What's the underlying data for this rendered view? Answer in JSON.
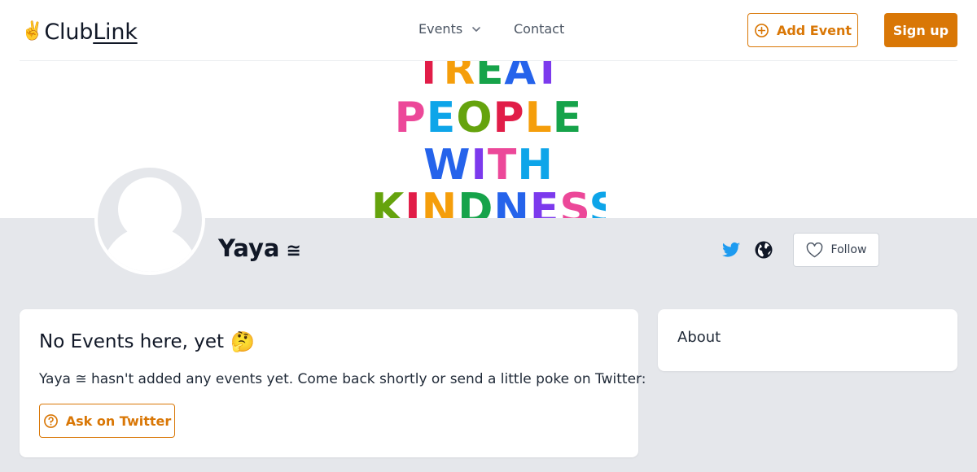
{
  "header": {
    "logo_emoji": "✌️",
    "logo_text_a": "Club",
    "logo_text_b": "Link",
    "nav": {
      "events_label": "Events",
      "contact_label": "Contact"
    },
    "add_event_label": "Add Event",
    "signup_label": "Sign up"
  },
  "banner": {
    "lines": [
      "TREAT",
      "PEOPLE",
      "WITH",
      "KINDNESS"
    ],
    "colors": [
      "#e11d48",
      "#f59e0b",
      "#16a34a",
      "#2563eb",
      "#7c3aed",
      "#ec4899",
      "#0ea5e9",
      "#65a30d"
    ]
  },
  "profile": {
    "name": "Yaya",
    "name_symbol": "≅",
    "follow_label": "Follow",
    "icons": [
      "twitter-icon",
      "globe-icon",
      "heart-icon"
    ]
  },
  "events_card": {
    "title": "No Events here, yet",
    "title_emoji": "🤔",
    "description": "Yaya ≅ hasn't added any events yet. Come back shortly or send a little poke on Twitter:",
    "ask_label": "Ask on Twitter"
  },
  "about_card": {
    "title": "About"
  },
  "colors": {
    "accent": "#d97706",
    "twitter": "#1d9bf0",
    "page_bg": "#e5e7eb"
  }
}
